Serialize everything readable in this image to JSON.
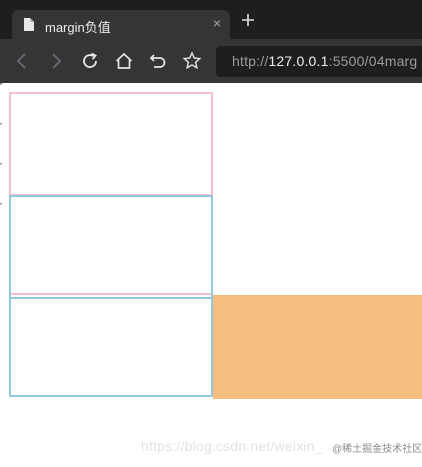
{
  "browser": {
    "tab": {
      "title": "margin负值",
      "close_glyph": "×",
      "favicon_icon": "page-icon"
    },
    "new_tab_icon": "plus-icon",
    "toolbar": {
      "back_icon": "back-arrow-icon",
      "forward_icon": "forward-arrow-icon",
      "reload_icon": "reload-icon",
      "home_icon": "home-icon",
      "undo_icon": "undo-icon",
      "bookmark_icon": "star-icon"
    },
    "address": {
      "scheme": "http://",
      "host": "127.0.0.1",
      "rest": ":5500/04marg"
    }
  },
  "page": {
    "box_colors": {
      "pink": "#f4bfc9",
      "blue": "#93c7e0",
      "orange": "#f5bd7e"
    },
    "watermark": {
      "url_text": "https://blog.csdn.net/weixin_",
      "badge_text": "@稀土掘金技术社区"
    }
  }
}
